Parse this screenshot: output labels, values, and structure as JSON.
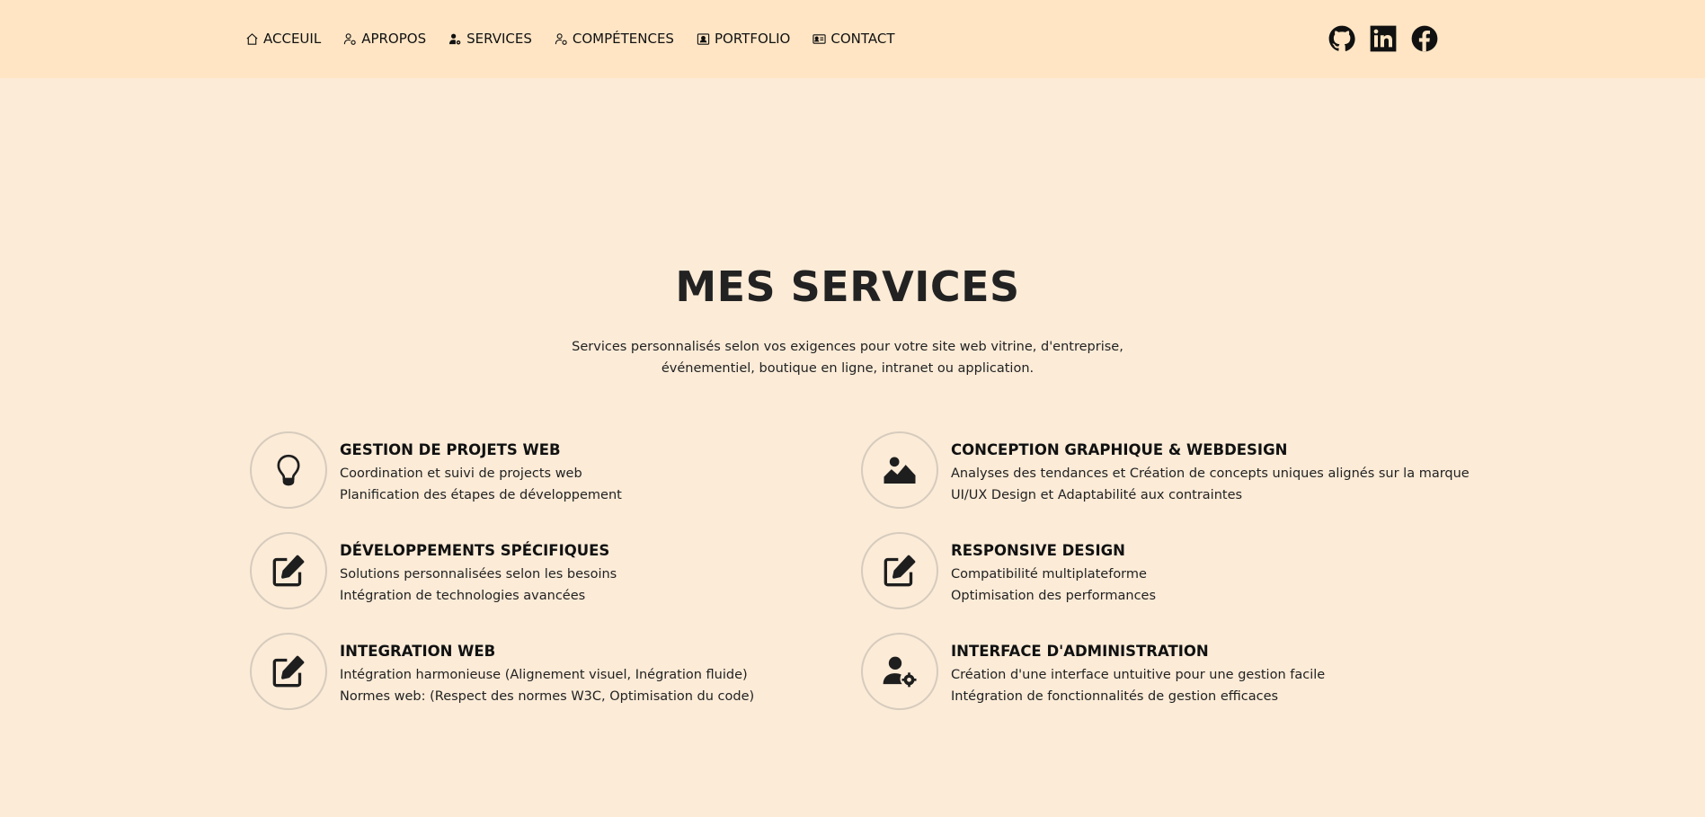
{
  "nav": {
    "items": [
      {
        "label": "ACCEUIL",
        "icon": "house-icon"
      },
      {
        "label": "APROPOS",
        "icon": "person-gear-icon"
      },
      {
        "label": "SERVICES",
        "icon": "person-gear-icon"
      },
      {
        "label": "COMPÉTENCES",
        "icon": "person-gear-icon"
      },
      {
        "label": "PORTFOLIO",
        "icon": "portrait-icon"
      },
      {
        "label": "CONTACT",
        "icon": "contact-card-icon"
      }
    ]
  },
  "social": {
    "items": [
      {
        "icon": "github-icon"
      },
      {
        "icon": "linkedin-icon"
      },
      {
        "icon": "facebook-icon"
      }
    ]
  },
  "section": {
    "title": "MES SERVICES",
    "subtitle_line1": "Services personnalisés selon vos exigences pour votre site web vitrine, d'entreprise,",
    "subtitle_line2": "événementiel, boutique en ligne, intranet ou application."
  },
  "services": [
    {
      "title": "GESTION DE PROJETS WEB",
      "line1": "Coordination et suivi de projects web",
      "line2": "Planification des étapes de développement",
      "icon": "lightbulb-icon"
    },
    {
      "title": "CONCEPTION GRAPHIQUE & WEBDESIGN",
      "line1": "Analyses des tendances et Création de concepts uniques alignés sur la marque",
      "line2": "UI/UX Design et Adaptabilité aux contraintes",
      "icon": "image-icon"
    },
    {
      "title": "DÉVELOPPEMENTS SPÉCIFIQUES",
      "line1": "Solutions personnalisées selon les besoins",
      "line2": "Intégration de technologies avancées",
      "icon": "edit-icon"
    },
    {
      "title": "RESPONSIVE DESIGN",
      "line1": "Compatibilité multiplateforme",
      "line2": "Optimisation des performances",
      "icon": "edit-icon"
    },
    {
      "title": "INTEGRATION WEB",
      "line1": "Intégration harmonieuse (Alignement visuel, Inégration fluide)",
      "line2": "Normes web: (Respect des normes W3C, Optimisation du code)",
      "icon": "edit-icon"
    },
    {
      "title": "INTERFACE D'ADMINISTRATION",
      "line1": "Création d'une interface untuitive pour une gestion facile",
      "line2": "Intégration de fonctionnalités de gestion efficaces",
      "icon": "user-gear-icon"
    }
  ]
}
